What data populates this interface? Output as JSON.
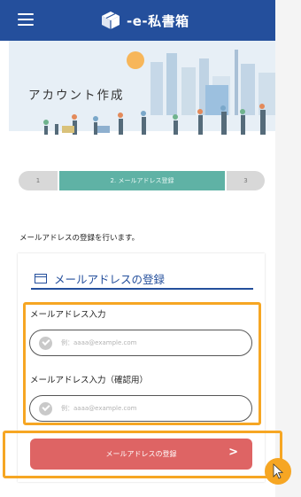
{
  "header": {
    "logo_text": "-e-私書箱"
  },
  "hero": {
    "title": "アカウント作成"
  },
  "stepper": {
    "steps": [
      "1",
      "2. メールアドレス登録",
      "3"
    ]
  },
  "intro": "メールアドレスの登録を行います。",
  "section": {
    "title": "メールアドレスの登録"
  },
  "fields": [
    {
      "label": "メールアドレス入力",
      "placeholder": "例：aaaa@example.com"
    },
    {
      "label": "メールアドレス入力（確認用）",
      "placeholder": "例：aaaa@example.com"
    }
  ],
  "submit": {
    "label": "メールアドレスの登録",
    "arrow": ">"
  },
  "colors": {
    "header": "#244f9c",
    "step_active": "#5fb2a5",
    "submit": "#de6464",
    "highlight": "#f6a623"
  },
  "icons": [
    "menu-icon",
    "logo-box-icon",
    "mail-icon",
    "check-icon",
    "cursor-icon"
  ]
}
